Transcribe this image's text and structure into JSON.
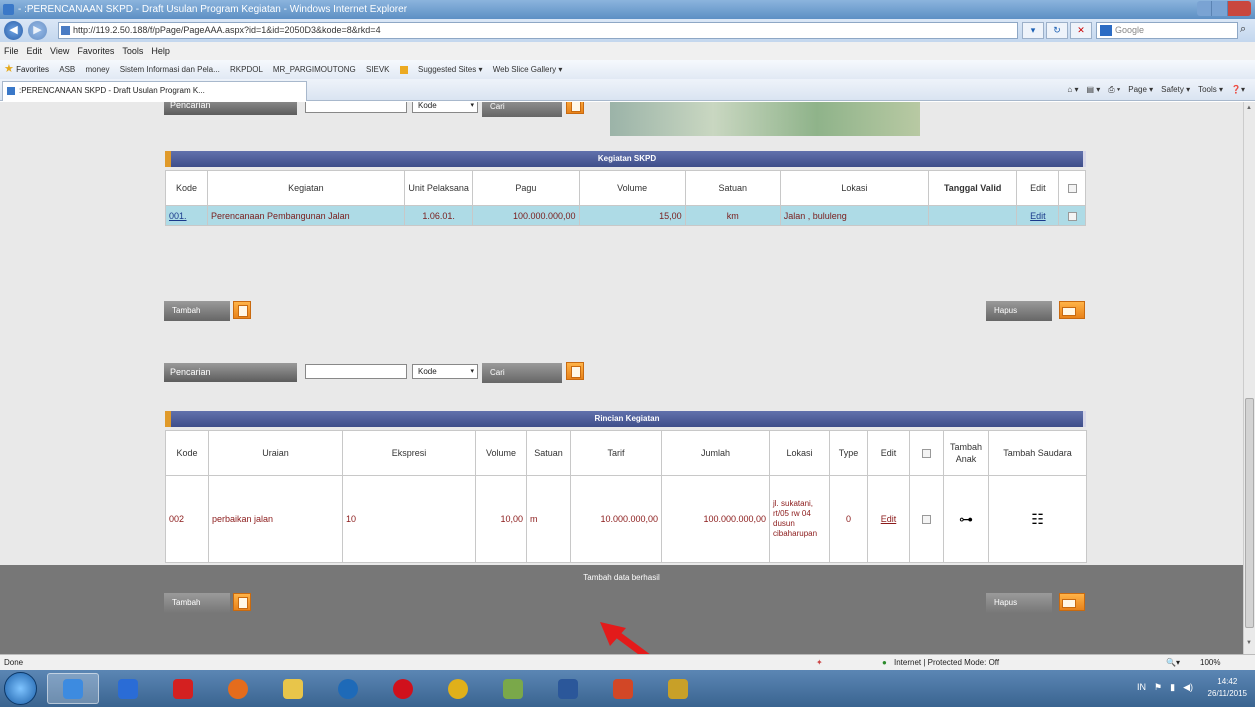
{
  "window": {
    "title": "- :PERENCANAAN SKPD - Draft Usulan Program Kegiatan - Windows Internet Explorer"
  },
  "address": {
    "url": "http://119.2.50.188/f/pPage/PageAAA.aspx?id=1&id=2050D3&kode=8&rkd=4"
  },
  "search": {
    "placeholder": "Google"
  },
  "menu": [
    "File",
    "Edit",
    "View",
    "Favorites",
    "Tools",
    "Help"
  ],
  "favorites": {
    "label": "Favorites",
    "items": [
      "ASB",
      "money",
      "Sistem Informasi dan Pela...",
      "RKPDOL",
      "MR_PARGIMOUTONG",
      "SIEVK",
      "Suggested Sites ▾",
      "Web Slice Gallery ▾"
    ]
  },
  "tab": {
    "label": ":PERENCANAAN SKPD - Draft Usulan Program K..."
  },
  "cmdbar": [
    "Page ▾",
    "Safety ▾",
    "Tools ▾"
  ],
  "search1": {
    "label": "Pencarian",
    "select": "Kode",
    "button": "Cari"
  },
  "kegiatan": {
    "title": "Kegiatan SKPD",
    "headers": [
      "Kode",
      "Kegiatan",
      "Unit Pelaksana",
      "Pagu",
      "Volume",
      "Satuan",
      "Lokasi",
      "Tanggal Valid",
      "Edit",
      ""
    ],
    "row": {
      "kode": "001.",
      "kegiatan": "Perencanaan Pembangunan Jalan",
      "unit": "1.06.01.",
      "pagu": "100.000.000,00",
      "volume": "15,00",
      "satuan": "km",
      "lokasi": "Jalan , bululeng",
      "tanggal": "",
      "edit": "Edit"
    }
  },
  "buttons1": {
    "tambah": "Tambah",
    "hapus": "Hapus"
  },
  "search2": {
    "label": "Pencarian",
    "select": "Kode",
    "button": "Cari"
  },
  "rincian": {
    "title": "Rincian Kegiatan",
    "headers": [
      "Kode",
      "Uraian",
      "Ekspresi",
      "Volume",
      "Satuan",
      "Tarif",
      "Jumlah",
      "Lokasi",
      "Type",
      "Edit",
      "",
      "Tambah Anak",
      "Tambah Saudara"
    ],
    "row": {
      "kode": "002",
      "uraian": "perbaikan jalan",
      "ekspresi": "10",
      "volume": "10,00",
      "satuan": "m",
      "tarif": "10.000.000,00",
      "jumlah": "100.000.000,00",
      "lokasi": "jl. sukatani, rt/05 rw 04 dusun cibaharupan",
      "type": "0",
      "edit": "Edit"
    }
  },
  "message": "Tambah data berhasil",
  "buttons2": {
    "tambah": "Tambah",
    "hapus": "Hapus"
  },
  "status": {
    "left": "Done",
    "zone": "Internet | Protected Mode: Off",
    "zoom": "100%"
  },
  "clock": {
    "time": "14:42",
    "date": "26/11/2015"
  }
}
